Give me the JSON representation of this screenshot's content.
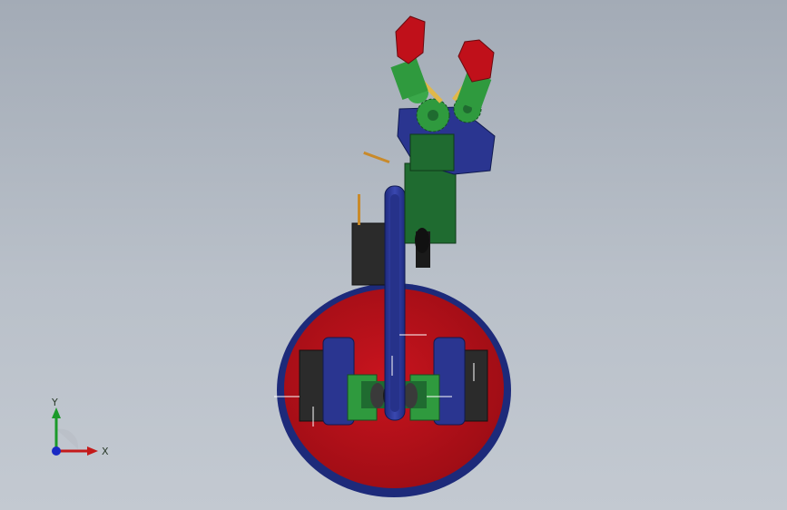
{
  "viewport": {
    "background_top": "#a3abb6",
    "background_bottom": "#c3c9d1"
  },
  "model": {
    "base_color": "#c0101a",
    "base_rim_color": "#1d2a7a",
    "link_color": "#2a3590",
    "bracket_color": "#1f6b30",
    "gear_color": "#2f9a3e",
    "servo_color": "#2b2b2b",
    "gripper_color": "#c0101a",
    "linkage_color": "#e0b84a"
  },
  "triad": {
    "x_label": "X",
    "y_label": "Y",
    "x_color": "#c41a1a",
    "y_color": "#1b9a2a",
    "z_color": "#1a2ac4"
  }
}
